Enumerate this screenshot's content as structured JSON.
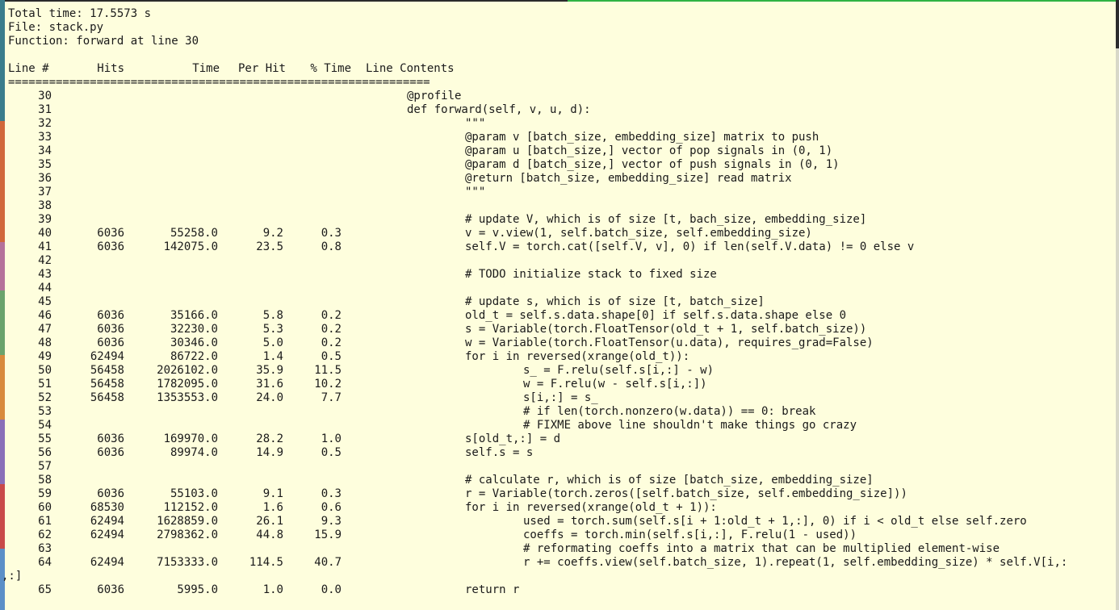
{
  "summary": {
    "total_time": "Total time: 17.5573 s",
    "file": "File: stack.py",
    "function": "Function: forward at line 30"
  },
  "header": {
    "line_no": "Line #",
    "hits": "Hits",
    "time": "Time",
    "per_hit": "Per Hit",
    "pct_time": "% Time",
    "contents": "Line Contents"
  },
  "separator": "==============================================================",
  "rows": [
    {
      "line": "30",
      "hits": "",
      "time": "",
      "per_hit": "",
      "pct": "",
      "indent": 0,
      "code": "@profile"
    },
    {
      "line": "31",
      "hits": "",
      "time": "",
      "per_hit": "",
      "pct": "",
      "indent": 0,
      "code": "def forward(self, v, u, d):"
    },
    {
      "line": "32",
      "hits": "",
      "time": "",
      "per_hit": "",
      "pct": "",
      "indent": 1,
      "code": "\"\"\""
    },
    {
      "line": "33",
      "hits": "",
      "time": "",
      "per_hit": "",
      "pct": "",
      "indent": 1,
      "code": "@param v [batch_size, embedding_size] matrix to push"
    },
    {
      "line": "34",
      "hits": "",
      "time": "",
      "per_hit": "",
      "pct": "",
      "indent": 1,
      "code": "@param u [batch_size,] vector of pop signals in (0, 1)"
    },
    {
      "line": "35",
      "hits": "",
      "time": "",
      "per_hit": "",
      "pct": "",
      "indent": 1,
      "code": "@param d [batch_size,] vector of push signals in (0, 1)"
    },
    {
      "line": "36",
      "hits": "",
      "time": "",
      "per_hit": "",
      "pct": "",
      "indent": 1,
      "code": "@return [batch_size, embedding_size] read matrix"
    },
    {
      "line": "37",
      "hits": "",
      "time": "",
      "per_hit": "",
      "pct": "",
      "indent": 1,
      "code": "\"\"\""
    },
    {
      "line": "38",
      "hits": "",
      "time": "",
      "per_hit": "",
      "pct": "",
      "indent": 0,
      "code": ""
    },
    {
      "line": "39",
      "hits": "",
      "time": "",
      "per_hit": "",
      "pct": "",
      "indent": 1,
      "code": "# update V, which is of size [t, bach_size, embedding_size]"
    },
    {
      "line": "40",
      "hits": "6036",
      "time": "55258.0",
      "per_hit": "9.2",
      "pct": "0.3",
      "indent": 1,
      "code": "v = v.view(1, self.batch_size, self.embedding_size)"
    },
    {
      "line": "41",
      "hits": "6036",
      "time": "142075.0",
      "per_hit": "23.5",
      "pct": "0.8",
      "indent": 1,
      "code": "self.V = torch.cat([self.V, v], 0) if len(self.V.data) != 0 else v"
    },
    {
      "line": "42",
      "hits": "",
      "time": "",
      "per_hit": "",
      "pct": "",
      "indent": 0,
      "code": ""
    },
    {
      "line": "43",
      "hits": "",
      "time": "",
      "per_hit": "",
      "pct": "",
      "indent": 1,
      "code": "# TODO initialize stack to fixed size"
    },
    {
      "line": "44",
      "hits": "",
      "time": "",
      "per_hit": "",
      "pct": "",
      "indent": 0,
      "code": ""
    },
    {
      "line": "45",
      "hits": "",
      "time": "",
      "per_hit": "",
      "pct": "",
      "indent": 1,
      "code": "# update s, which is of size [t, batch_size]"
    },
    {
      "line": "46",
      "hits": "6036",
      "time": "35166.0",
      "per_hit": "5.8",
      "pct": "0.2",
      "indent": 1,
      "code": "old_t = self.s.data.shape[0] if self.s.data.shape else 0"
    },
    {
      "line": "47",
      "hits": "6036",
      "time": "32230.0",
      "per_hit": "5.3",
      "pct": "0.2",
      "indent": 1,
      "code": "s = Variable(torch.FloatTensor(old_t + 1, self.batch_size))"
    },
    {
      "line": "48",
      "hits": "6036",
      "time": "30346.0",
      "per_hit": "5.0",
      "pct": "0.2",
      "indent": 1,
      "code": "w = Variable(torch.FloatTensor(u.data), requires_grad=False)"
    },
    {
      "line": "49",
      "hits": "62494",
      "time": "86722.0",
      "per_hit": "1.4",
      "pct": "0.5",
      "indent": 1,
      "code": "for i in reversed(xrange(old_t)):"
    },
    {
      "line": "50",
      "hits": "56458",
      "time": "2026102.0",
      "per_hit": "35.9",
      "pct": "11.5",
      "indent": 2,
      "code": "s_ = F.relu(self.s[i,:] - w)"
    },
    {
      "line": "51",
      "hits": "56458",
      "time": "1782095.0",
      "per_hit": "31.6",
      "pct": "10.2",
      "indent": 2,
      "code": "w = F.relu(w - self.s[i,:])"
    },
    {
      "line": "52",
      "hits": "56458",
      "time": "1353553.0",
      "per_hit": "24.0",
      "pct": "7.7",
      "indent": 2,
      "code": "s[i,:] = s_"
    },
    {
      "line": "53",
      "hits": "",
      "time": "",
      "per_hit": "",
      "pct": "",
      "indent": 2,
      "code": "# if len(torch.nonzero(w.data)) == 0: break"
    },
    {
      "line": "54",
      "hits": "",
      "time": "",
      "per_hit": "",
      "pct": "",
      "indent": 2,
      "code": "# FIXME above line shouldn't make things go crazy"
    },
    {
      "line": "55",
      "hits": "6036",
      "time": "169970.0",
      "per_hit": "28.2",
      "pct": "1.0",
      "indent": 1,
      "code": "s[old_t,:] = d"
    },
    {
      "line": "56",
      "hits": "6036",
      "time": "89974.0",
      "per_hit": "14.9",
      "pct": "0.5",
      "indent": 1,
      "code": "self.s = s"
    },
    {
      "line": "57",
      "hits": "",
      "time": "",
      "per_hit": "",
      "pct": "",
      "indent": 0,
      "code": ""
    },
    {
      "line": "58",
      "hits": "",
      "time": "",
      "per_hit": "",
      "pct": "",
      "indent": 1,
      "code": "# calculate r, which is of size [batch_size, embedding_size]"
    },
    {
      "line": "59",
      "hits": "6036",
      "time": "55103.0",
      "per_hit": "9.1",
      "pct": "0.3",
      "indent": 1,
      "code": "r = Variable(torch.zeros([self.batch_size, self.embedding_size]))"
    },
    {
      "line": "60",
      "hits": "68530",
      "time": "112152.0",
      "per_hit": "1.6",
      "pct": "0.6",
      "indent": 1,
      "code": "for i in reversed(xrange(old_t + 1)):"
    },
    {
      "line": "61",
      "hits": "62494",
      "time": "1628859.0",
      "per_hit": "26.1",
      "pct": "9.3",
      "indent": 2,
      "code": "used = torch.sum(self.s[i + 1:old_t + 1,:], 0) if i < old_t else self.zero"
    },
    {
      "line": "62",
      "hits": "62494",
      "time": "2798362.0",
      "per_hit": "44.8",
      "pct": "15.9",
      "indent": 2,
      "code": "coeffs = torch.min(self.s[i,:], F.relu(1 - used))"
    },
    {
      "line": "63",
      "hits": "",
      "time": "",
      "per_hit": "",
      "pct": "",
      "indent": 2,
      "code": "# reformating coeffs into a matrix that can be multiplied element-wise"
    },
    {
      "line": "64",
      "hits": "62494",
      "time": "7153333.0",
      "per_hit": "114.5",
      "pct": "40.7",
      "indent": 2,
      "code": "r += coeffs.view(self.batch_size, 1).repeat(1, self.embedding_size) * self.V[i,:"
    },
    {
      "line": "",
      "hits": "",
      "time": "",
      "per_hit": "",
      "pct": "",
      "indent": -1,
      "code": ",:]"
    },
    {
      "line": "65",
      "hits": "6036",
      "time": "5995.0",
      "per_hit": "1.0",
      "pct": "0.0",
      "indent": 1,
      "code": "return r"
    }
  ]
}
